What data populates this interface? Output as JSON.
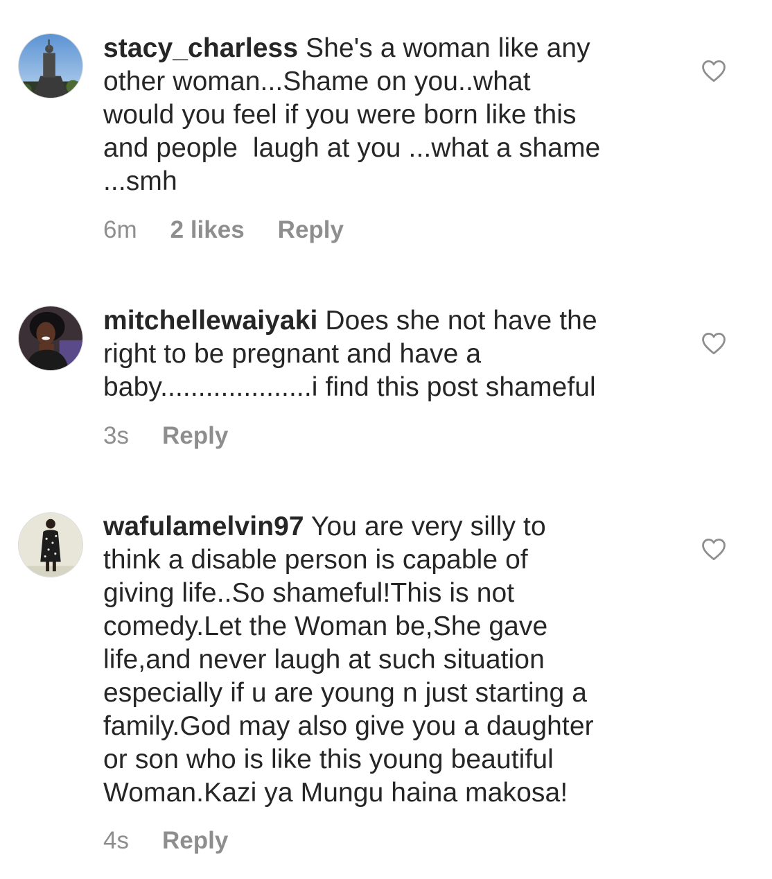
{
  "comments": [
    {
      "username": "stacy_charless",
      "first_line_rest": " She's a woman like any",
      "more_lines": [
        "other woman...Shame on you..what",
        "would you feel if you were born like this",
        "and people  laugh at you ...what a shame",
        "...smh"
      ],
      "time": "6m",
      "likes": "2 likes",
      "reply": "Reply",
      "avatar_icon": "statue-photo-avatar",
      "like_icon": "heart-outline-icon"
    },
    {
      "username": "mitchellewaiyaki",
      "first_line_rest": " Does she not have the",
      "more_lines": [
        "right to be pregnant and have a",
        "baby....................i find this post shameful"
      ],
      "time": "3s",
      "reply": "Reply",
      "avatar_icon": "woman-portrait-avatar",
      "like_icon": "heart-outline-icon"
    },
    {
      "username": "wafulamelvin97",
      "first_line_rest": " You are very silly to",
      "more_lines": [
        "think a disable person is capable of",
        "giving life..So shameful!This is not",
        "comedy.Let the Woman be,She gave",
        "life,and never laugh at such situation",
        "especially if u are young n just starting a",
        "family.God may also give you a daughter",
        "or son who is like this young beautiful",
        "Woman.Kazi ya Mungu haina makosa!"
      ],
      "time": "4s",
      "reply": "Reply",
      "avatar_icon": "person-standing-avatar",
      "like_icon": "heart-outline-icon"
    }
  ],
  "colors": {
    "text": "#262626",
    "meta": "#8e8e8e",
    "heart": "#8e8e8e"
  }
}
